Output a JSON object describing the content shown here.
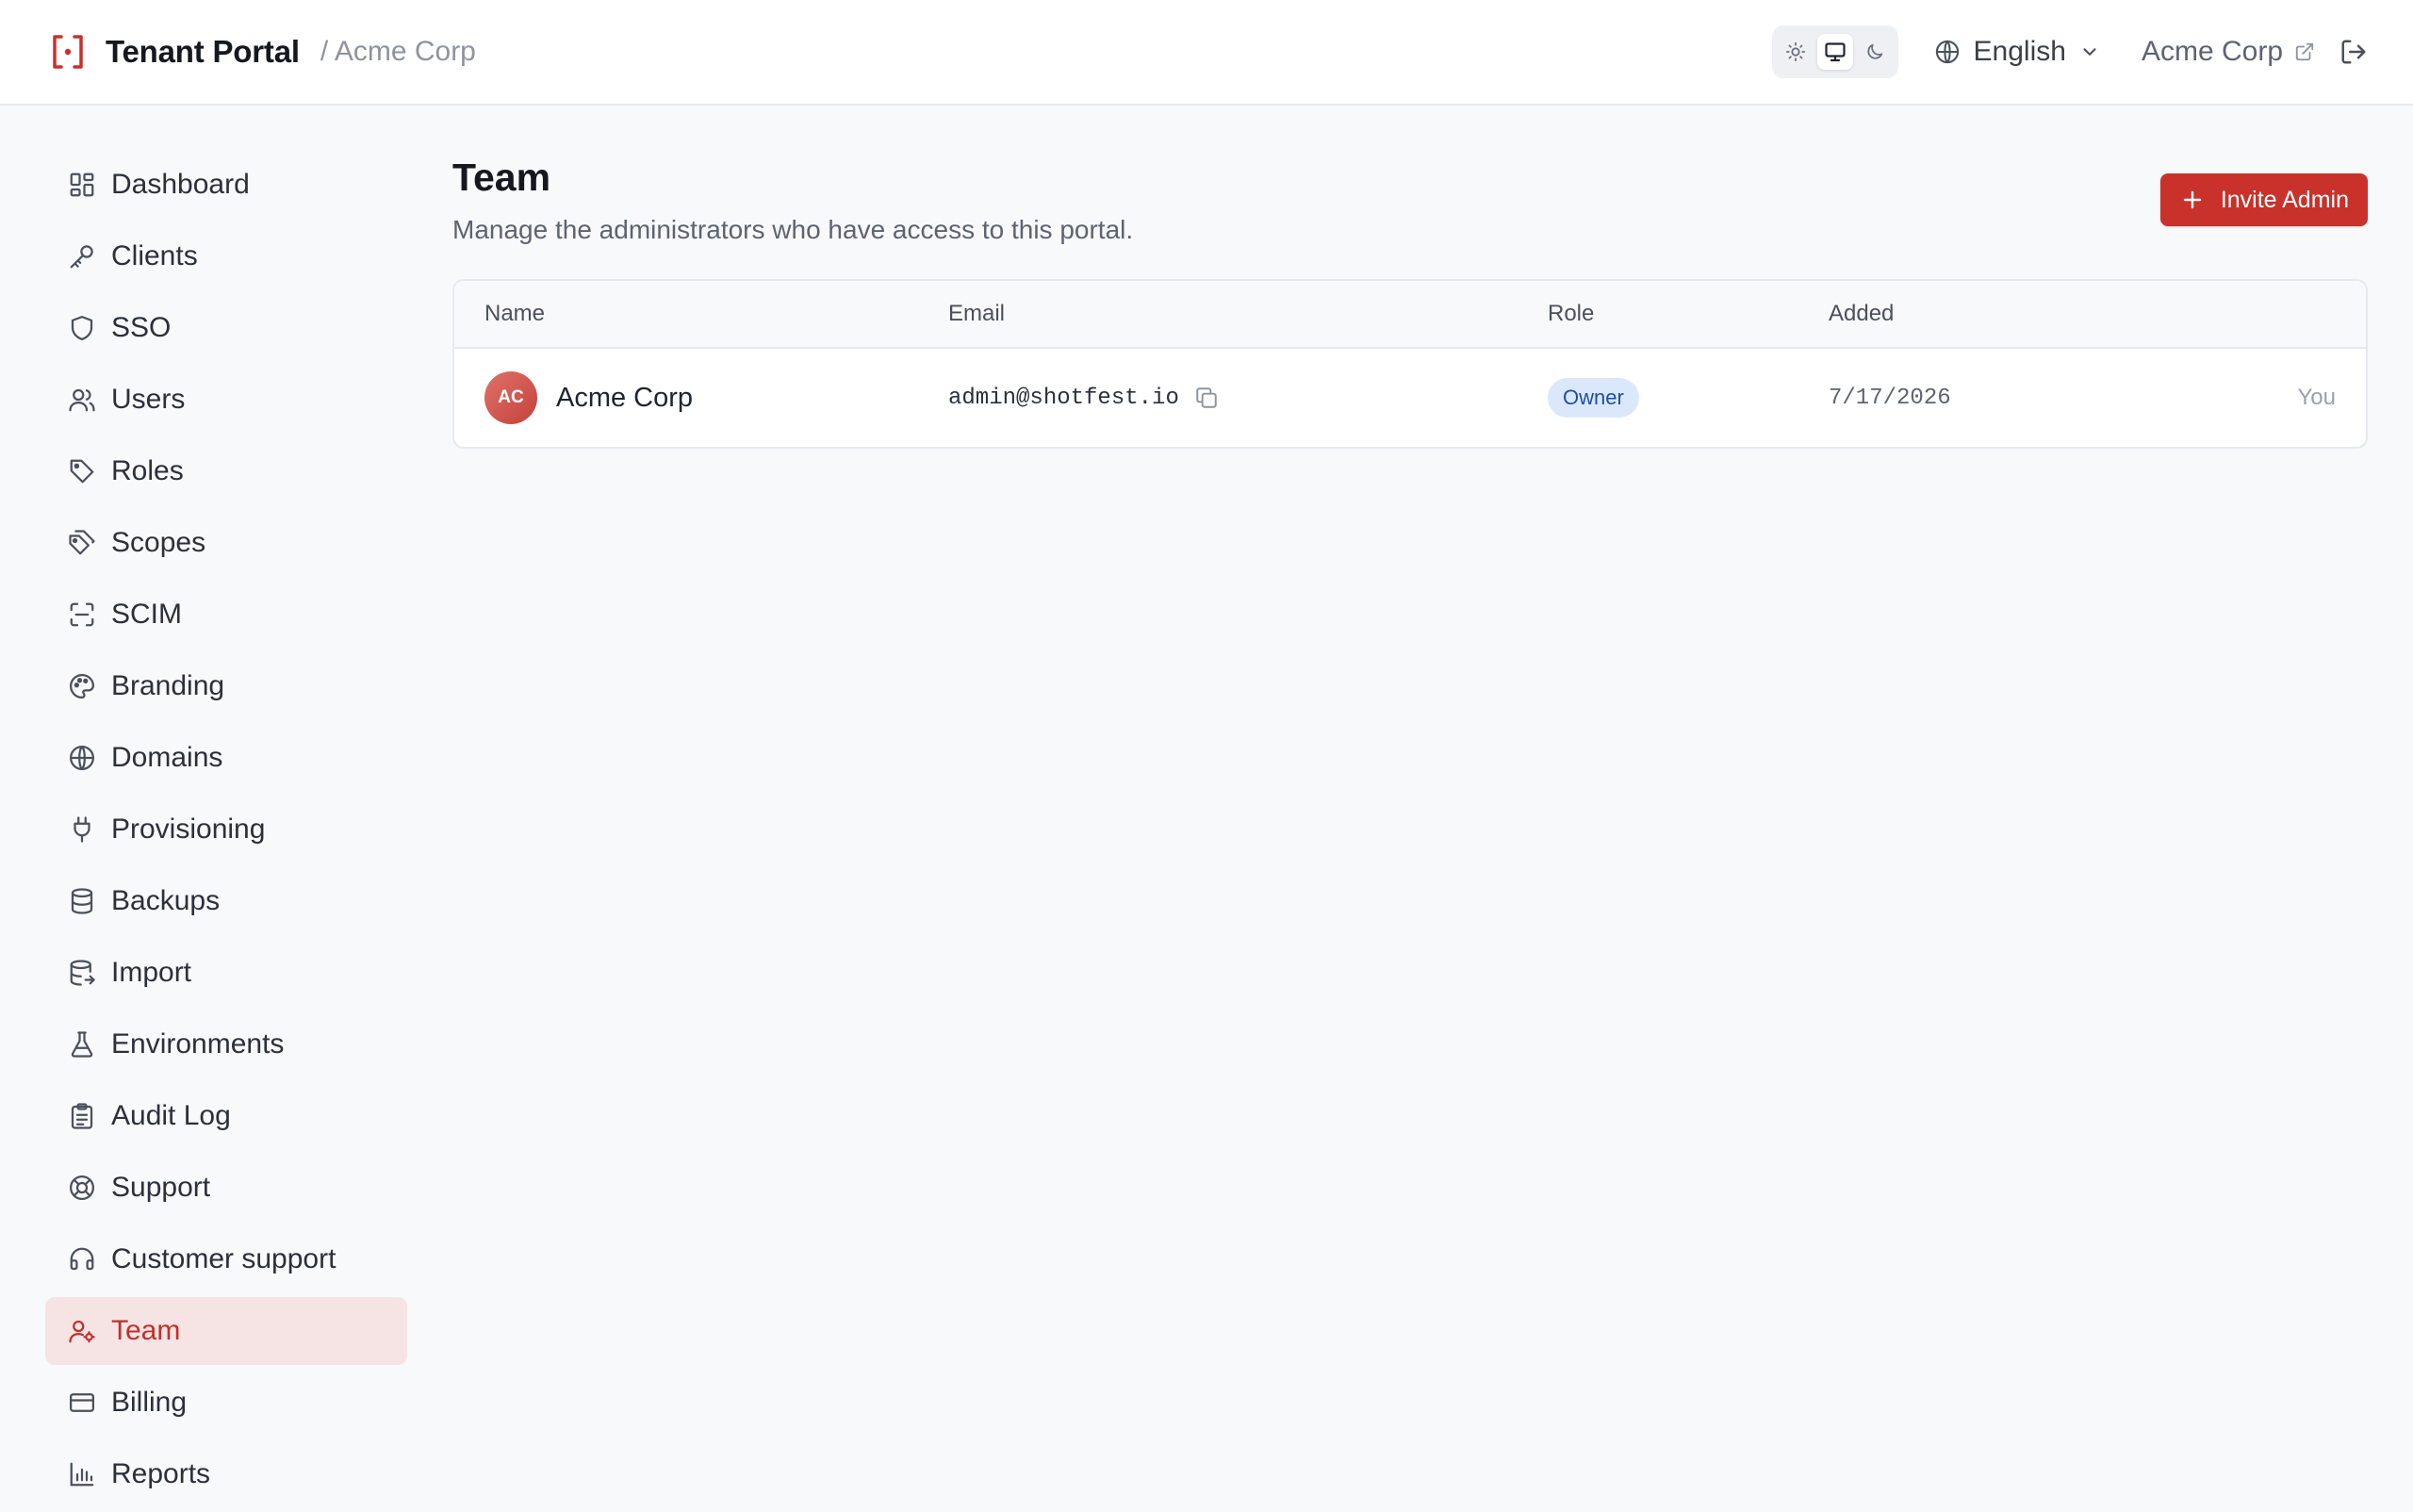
{
  "header": {
    "brand_title": "Tenant Portal",
    "breadcrumb": "/ Acme Corp",
    "theme_options": [
      "light",
      "system",
      "dark"
    ],
    "theme_selected": "system",
    "language": "English",
    "tenant_link": "Acme Corp"
  },
  "sidebar": {
    "items": [
      {
        "label": "Dashboard",
        "icon": "dashboard-icon"
      },
      {
        "label": "Clients",
        "icon": "key-icon"
      },
      {
        "label": "SSO",
        "icon": "shield-icon"
      },
      {
        "label": "Users",
        "icon": "users-icon"
      },
      {
        "label": "Roles",
        "icon": "tag-icon"
      },
      {
        "label": "Scopes",
        "icon": "tags-icon"
      },
      {
        "label": "SCIM",
        "icon": "scan-icon"
      },
      {
        "label": "Branding",
        "icon": "palette-icon"
      },
      {
        "label": "Domains",
        "icon": "globe-icon"
      },
      {
        "label": "Provisioning",
        "icon": "plug-icon"
      },
      {
        "label": "Backups",
        "icon": "database-icon"
      },
      {
        "label": "Import",
        "icon": "database-import-icon"
      },
      {
        "label": "Environments",
        "icon": "flask-icon"
      },
      {
        "label": "Audit Log",
        "icon": "clipboard-icon"
      },
      {
        "label": "Support",
        "icon": "life-buoy-icon"
      },
      {
        "label": "Customer support",
        "icon": "headset-icon"
      },
      {
        "label": "Team",
        "icon": "user-cog-icon",
        "active": true
      },
      {
        "label": "Billing",
        "icon": "credit-card-icon"
      },
      {
        "label": "Reports",
        "icon": "bar-chart-icon"
      }
    ]
  },
  "main": {
    "title": "Team",
    "subtitle": "Manage the administrators who have access to this portal.",
    "invite_label": "Invite Admin",
    "table": {
      "headers": {
        "name": "Name",
        "email": "Email",
        "role": "Role",
        "added": "Added"
      },
      "rows": [
        {
          "initials": "AC",
          "name": "Acme Corp",
          "email": "admin@shotfest.io",
          "role": "Owner",
          "added": "7/17/2026",
          "note": "You"
        }
      ]
    }
  },
  "colors": {
    "accent": "#c8322b",
    "active_nav_bg": "#f6e4e4",
    "role_badge_bg": "#dbe8fb",
    "role_badge_text": "#1e4fa3"
  }
}
